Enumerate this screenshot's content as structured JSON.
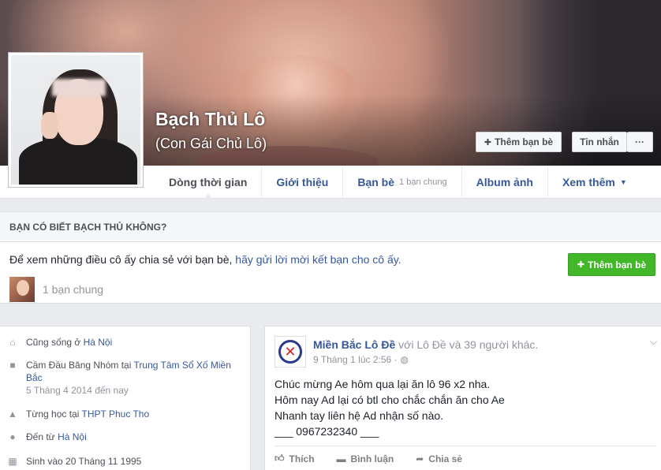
{
  "profile": {
    "name": "Bạch Thủ Lô",
    "alternate_name": "(Con Gái Chủ Lô)",
    "add_friend_label": "Thêm bạn bè",
    "message_label": "Tin nhắn",
    "more_label": "···"
  },
  "nav": {
    "tabs": [
      {
        "label": "Dòng thời gian",
        "active": true
      },
      {
        "label": "Giới thiệu"
      },
      {
        "label": "Bạn bè",
        "sub": "1 bạn chung"
      },
      {
        "label": "Album ảnh"
      },
      {
        "label": "Xem thêm",
        "dropdown": "▼"
      }
    ]
  },
  "know_card": {
    "heading": "BẠN CÓ BIẾT BẠCH THỦ KHÔNG?",
    "text_prefix": "Để xem những điều cô ấy chia sẻ với bạn bè, ",
    "text_link": "hãy gửi lời mời kết bạn cho cô ấy.",
    "button_label": "Thêm bạn bè",
    "mutual_label": "1 bạn chung"
  },
  "intro": {
    "items": [
      {
        "icon": "home-icon",
        "prefix": "Cũng sống ở ",
        "link": "Hà Nội"
      },
      {
        "icon": "briefcase-icon",
        "prefix": "Cầm Đầu Băng Nhóm tại ",
        "link": "Trung Tâm Sổ Xố Miền Bắc",
        "meta": "5 Tháng 4 2014 đến nay"
      },
      {
        "icon": "graduation-cap-icon",
        "prefix": "Từng học tại ",
        "link": "THPT Phuc Tho"
      },
      {
        "icon": "location-pin-icon",
        "prefix": "Đến từ ",
        "link": "Hà Nội"
      },
      {
        "icon": "calendar-icon",
        "prefix": "Sinh vào 20 Tháng 11 1995"
      }
    ]
  },
  "post": {
    "author": "Miền Bắc Lô Đề",
    "with_text": " với Lô Đề và 39 người khác.",
    "timestamp": "9 Tháng 1 lúc 2:56 ·",
    "lines": [
      "Chúc mừng Ae hôm qua lại ăn lô 96 x2 nha.",
      "Hôm nay Ad lại có btl cho chắc chắn ăn cho Ae",
      "Nhanh tay liên hệ Ad nhận số nào.",
      "___ 0967232340 ___"
    ],
    "actions": {
      "like": "Thích",
      "comment": "Bình luận",
      "share": "Chia sẻ"
    }
  },
  "colors": {
    "link": "#365899",
    "green": "#42b72a",
    "page_bg": "#e9ebee"
  }
}
